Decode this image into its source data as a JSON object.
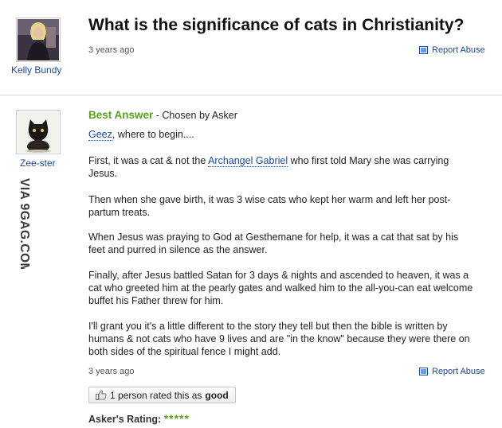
{
  "question": {
    "title": "What is the significance of cats in Christianity?",
    "time": "3 years ago",
    "report": "Report Abuse",
    "asker": "Kelly Bundy"
  },
  "answer": {
    "user": "Zee-ster",
    "best_label": "Best Answer",
    "chosen_by": " - Chosen by Asker",
    "p1_link": "Geez",
    "p1_rest": ", where to begin....",
    "p2_a": "First, it was a cat & not the ",
    "p2_link": "Archangel Gabriel",
    "p2_b": " who first told Mary she was carrying Jesus.",
    "p3": "Then when she gave birth, it was 3 wise cats who kept her warm and left her post-partum treats.",
    "p4": "When Jesus was praying to God at Gesthemane for help, it was a cat that sat by his feet and purred in silence as the answer.",
    "p5": "Finally, after Jesus battled Satan for 3 days & nights and ascended to heaven, it was a cat who greeted him at the pearly gates and walked him to the all-you-can eat welcome buffet his Father threw for him.",
    "p6": "I'll grant you it's a little different to the story they tell but then the bible is written by humans & not cats who have 9 lives and are \"in the know\" because they were there on both sides of the spiritual fence I might add.",
    "time": "3 years ago",
    "report": "Report Abuse",
    "rated_prefix": "1 person rated this as ",
    "rated_value": "good",
    "asker_rating_label": "Asker's Rating:",
    "asker_rating_stars": "*****",
    "rating": 5
  },
  "watermark": "VIA 9GAG.COM",
  "colors": {
    "link": "#1a4a9c",
    "best": "#5aa21b"
  }
}
